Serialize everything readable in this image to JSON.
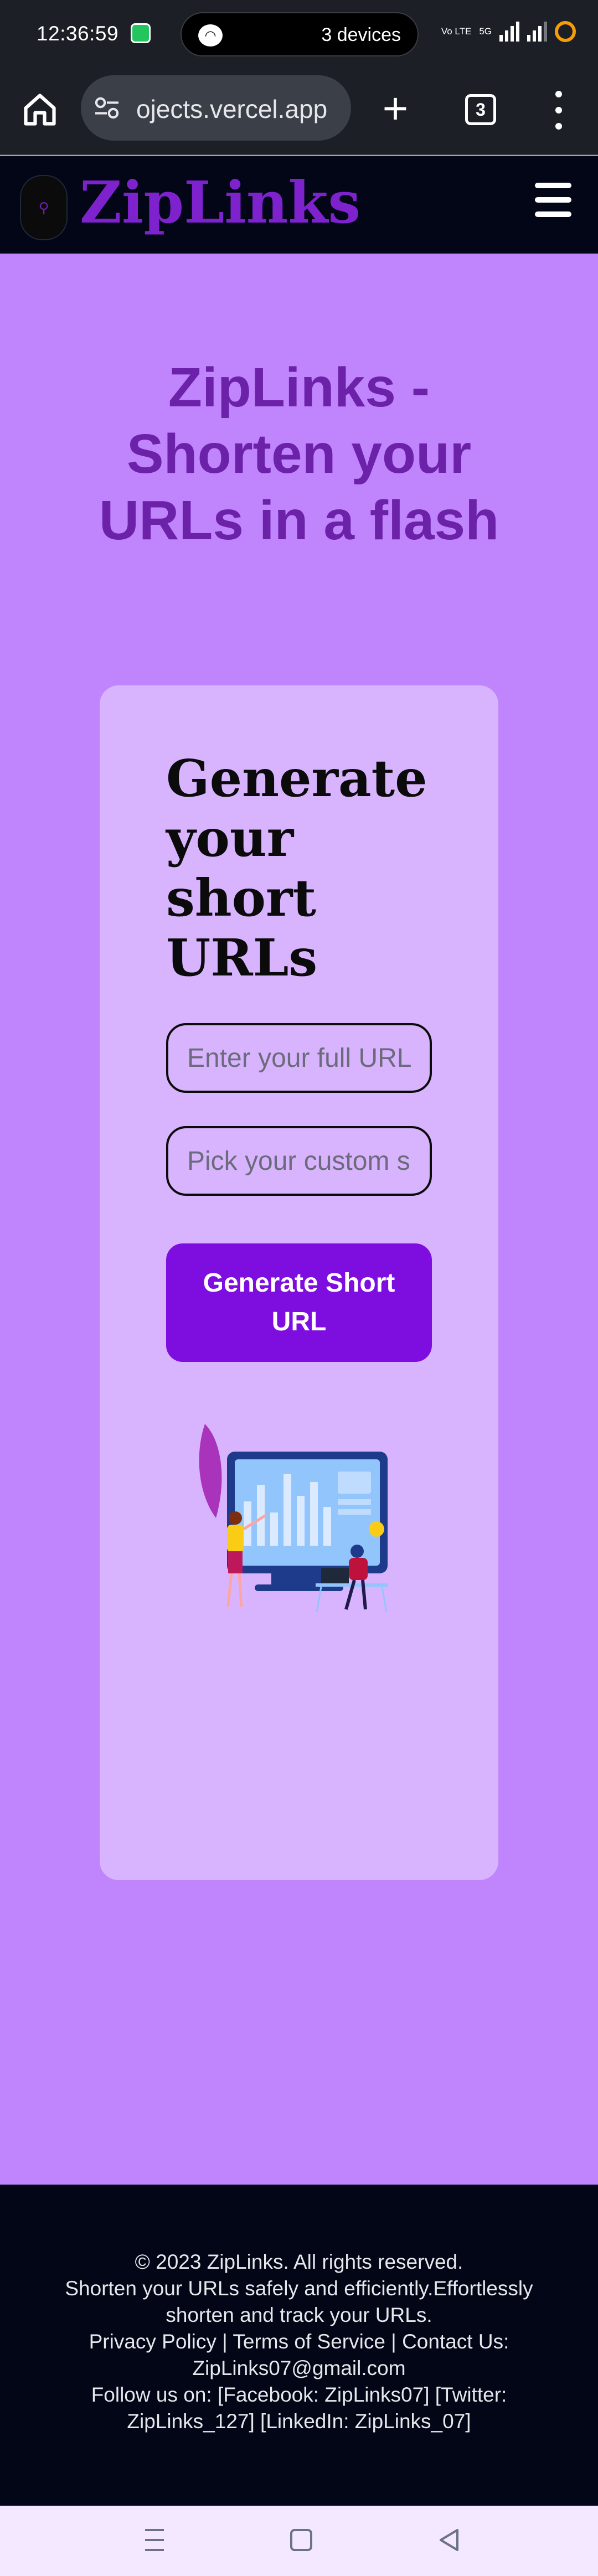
{
  "status_bar": {
    "time": "12:36:59",
    "devices_label": "3 devices",
    "network_label": "Vo LTE",
    "network_gen": "5G"
  },
  "browser": {
    "url": "ojects.vercel.app",
    "tab_count": "3",
    "icons": [
      "home-icon",
      "tune-icon",
      "plus-icon",
      "tabs-icon",
      "more-icon"
    ]
  },
  "site_header": {
    "brand": "ZipLinks",
    "logo_glyph": "⚲",
    "menu_icon": "hamburger-icon"
  },
  "hero": {
    "title": "ZipLinks - Shorten your URLs in a flash"
  },
  "card": {
    "title": "Generate your short URLs",
    "url_input": {
      "placeholder": "Enter your full URL",
      "value": ""
    },
    "custom_input": {
      "placeholder": "Pick your custom short URL",
      "value": ""
    },
    "generate_button": "Generate Short URL"
  },
  "footer": {
    "copyright": "© 2023 ZipLinks. All rights reserved.",
    "tagline": "Shorten your URLs safely and efficiently.Effortlessly shorten and track your URLs.",
    "links": "Privacy Policy | Terms of Service | Contact Us: ZipLinks07@gmail.com",
    "social": "Follow us on: [Facebook: ZipLinks07] [Twitter: ZipLinks_127] [LinkedIn: ZipLinks_07]"
  },
  "colors": {
    "page_bg": "#c084fc",
    "card_bg": "#d8b4fe",
    "accent": "#7e0ee0",
    "brand": "#7e22ce",
    "header_bg": "#020617"
  }
}
